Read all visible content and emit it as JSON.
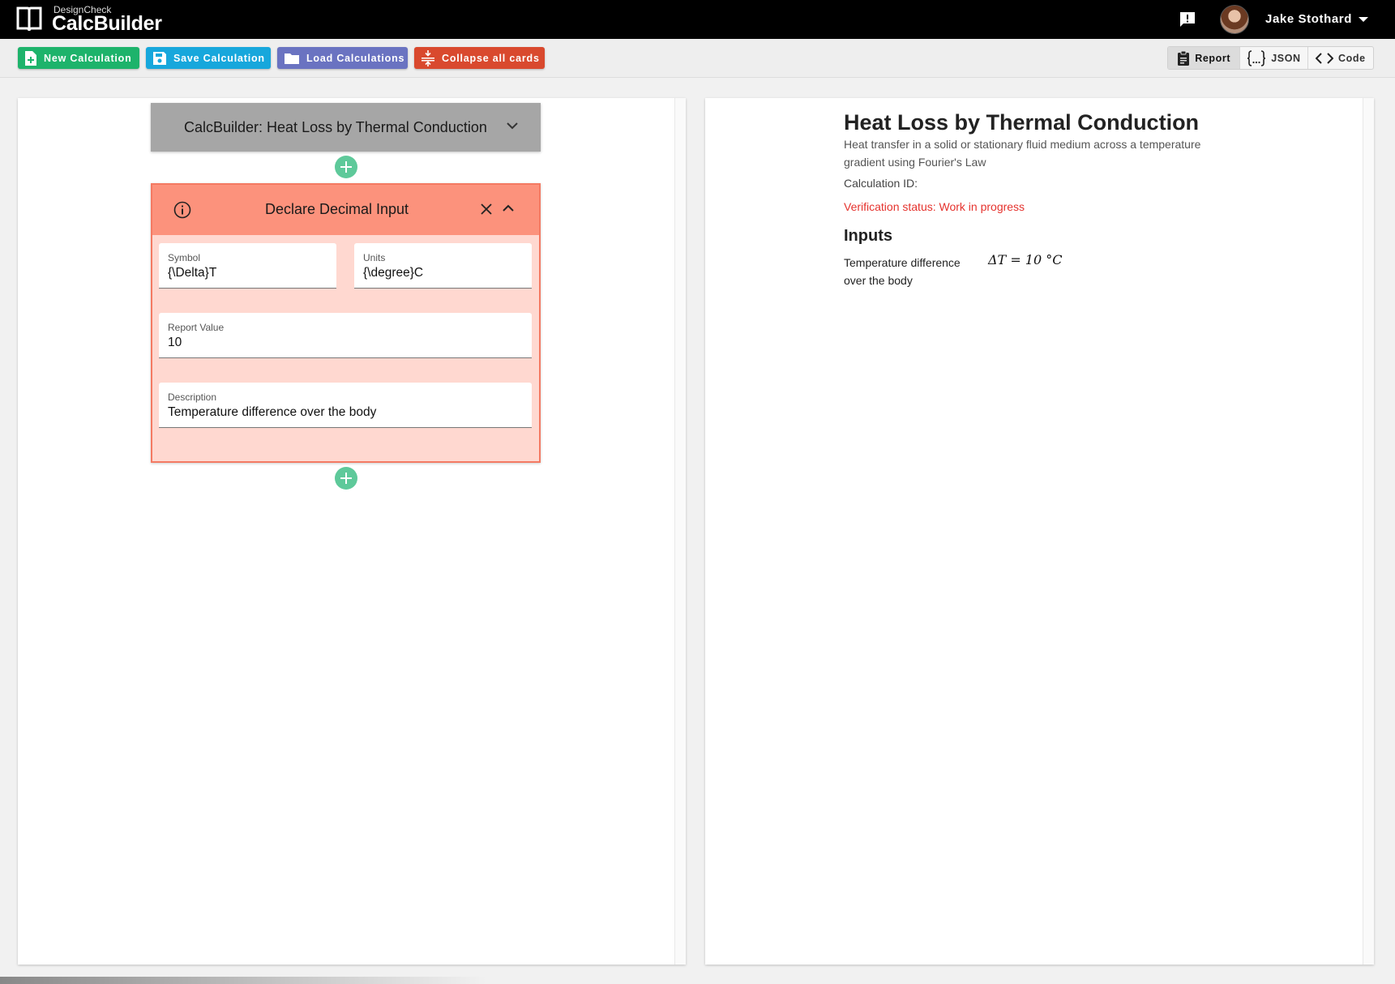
{
  "app": {
    "brand_small": "DesignCheck",
    "brand_name": "CalcBuilder",
    "user_name": "Jake Stothard"
  },
  "toolbar": {
    "new_label": "New Calculation",
    "save_label": "Save Calculation",
    "load_label": "Load Calculations",
    "collapse_label": "Collapse all cards",
    "views": [
      {
        "label": "Report",
        "active": true,
        "icon": "clipboard-icon"
      },
      {
        "label": "JSON",
        "active": false,
        "icon": "braces-icon"
      },
      {
        "label": "Code",
        "active": false,
        "icon": "code-icon"
      }
    ],
    "colors": {
      "new": "#1db36b",
      "save": "#17a7dc",
      "load": "#6a73c1",
      "collapse": "#d9492e"
    }
  },
  "builder": {
    "header_title": "CalcBuilder: Heat Loss by Thermal Conduction",
    "input_card": {
      "title": "Declare Decimal Input",
      "symbol_label": "Symbol",
      "symbol_value": "{\\Delta}T",
      "units_label": "Units",
      "units_value": "{\\degree}C",
      "report_value_label": "Report Value",
      "report_value": "10",
      "description_label": "Description",
      "description_value": "Temperature difference over the body"
    }
  },
  "report": {
    "title": "Heat Loss by Thermal Conduction",
    "description": "Heat transfer in a solid or stationary fluid medium across a temperature gradient using Fourier's Law",
    "calc_id": "Calculation ID:",
    "status": "Verification status: Work in progress",
    "inputs_heading": "Inputs",
    "inputs": [
      {
        "description": "Temperature difference over the body",
        "equation": "ΔT = 10 °C"
      }
    ]
  }
}
